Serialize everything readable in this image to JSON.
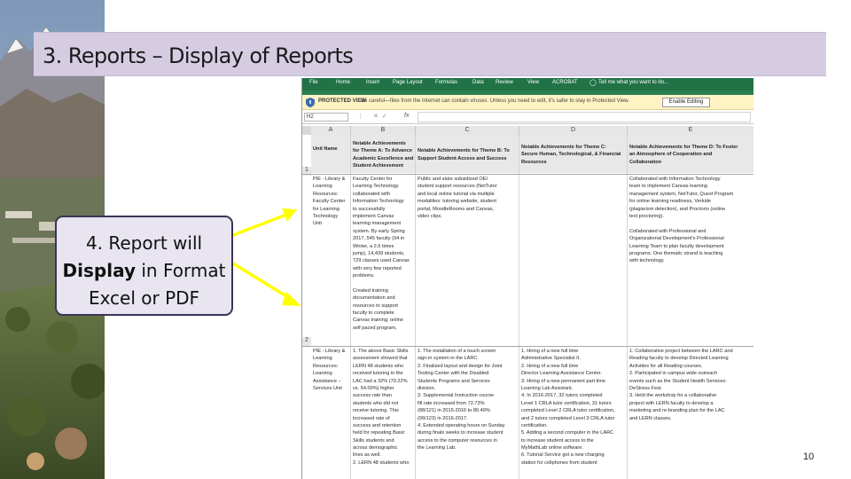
{
  "slide": {
    "title": "3. Reports – Display of Reports",
    "page_number": "10"
  },
  "callout": {
    "line1": "4. Report will",
    "line2_bold": "Display",
    "line2_rest": " in Format",
    "line3": "Excel or PDF"
  },
  "excel": {
    "ribbon_tabs": [
      "File",
      "Home",
      "Insert",
      "Page Layout",
      "Formulas",
      "Data",
      "Review",
      "View",
      "ACROBAT"
    ],
    "tell_me": "Tell me what you want to do...",
    "protected_view": {
      "label": "PROTECTED VIEW",
      "message": "Be careful—files from the Internet can contain viruses. Unless you need to edit, it's safer to stay in Protected View.",
      "button": "Enable Editing"
    },
    "name_box": "H2",
    "fx_label": "fx",
    "columns": [
      "A",
      "B",
      "C",
      "D",
      "E"
    ],
    "rows": [
      "1",
      "2"
    ],
    "header": {
      "a": [
        "",
        "Unit Name"
      ],
      "b": [
        "Notable Achievements",
        "for Theme A: To Advance",
        "Academic Excellence and",
        "Student Achievement"
      ],
      "c": [
        "",
        "Notable Achievements for Theme B: To",
        "Support Student Access and Success",
        ""
      ],
      "d": [
        "Notable Achievements for Theme C:",
        "Secure Human, Technological, & Financial",
        "Resources"
      ],
      "e": [
        "Notable Achievements for Theme D: To Foster",
        "an Atmosphere of Cooperation and",
        "Collaboration"
      ]
    },
    "row1": {
      "a": [
        "PIE - Library &",
        "Learning",
        "Resources:",
        "Faculty Center",
        "for Learning",
        "Technology",
        "Unit"
      ],
      "b": [
        "Faculty Center for",
        "Learning Technology",
        "collaborated with",
        "Information Technology",
        "to successfully",
        "implement Canvas",
        "learning management",
        "system. By early Spring",
        "2017, 545 faculty (94 in",
        "Winter, a 2.6 times",
        "jump), 14,439 students,",
        "729 classes used Canvas",
        "with very few reported",
        "problems.",
        "",
        "Created training",
        "documentation and",
        "resources to support",
        "faculty to complete",
        "Canvas training; online",
        "self paced program,"
      ],
      "c": [
        "Public and state subsidized OEI",
        "student support resources (NetTutor",
        "and local online tutorial via multiple",
        "modalities: tutoring website, student",
        "portal, MoodleRooms and Canvas,",
        "video clips."
      ],
      "d": [],
      "e": [
        "Collaborated with Information Technology",
        "team to implement Canvas learning",
        "management system, NetTutor, Quest Program",
        "for online learning readiness, Verkide",
        "(plagiarism detection), and Proctorio (online",
        "test proctoring).",
        "",
        "Collaborated with Professional and",
        "Organizational Development's Professional",
        "Learning Team to plan faculty development",
        "programs. One thematic strand is teaching",
        "with technology."
      ]
    },
    "row2": {
      "a": [
        "PIE - Library &",
        "Learning",
        "Resources:",
        "Learning",
        "Assistance –",
        "Services Unit"
      ],
      "b": [
        "1. The above Basic Skills",
        "assessment showed that",
        "LERN 48 students who",
        "received tutoring in the",
        "LAC had a 32% (70.22%",
        "vs. 54.00%) higher",
        "success rate than",
        "students who did not",
        "receive tutoring. This",
        "increased rate of",
        "success and retention",
        "held for repeating Basic",
        "Skills students and",
        "across demographic",
        "lines as well.",
        "2. LERN 48 students who"
      ],
      "c": [
        "1. The installation of a touch screen",
        "sign-in system in the LARC.",
        "2. Finalized layout and design for Joint",
        "Testing Center with the Disabled",
        "Students Programs and Services",
        "division.",
        "3. Supplemental Instruction course",
        "fill rate increased from 72.73%",
        "(88/121) in 2015-2016 to 80.49%",
        "(99/123) in 2016-2017.",
        "4. Extended operating hours on Sunday",
        "during finals weeks to increase student",
        "access to the computer resources in",
        "the Learning Lab."
      ],
      "d": [
        "1. Hiring of a new full time",
        "Administrative Specialist II.",
        "2. Hiring of a new full time",
        "Director Learning Assistance Center.",
        "3. Hiring of a new permanent part time",
        "Learning Lab Assistant.",
        "4. In 2016-2017, 32 tutors completed",
        "Level 1 CRLA tutor certification, 31 tutors",
        "completed Level 2 CRLA tutor certification,",
        "and 2 tutors completed Level 3 CRLA tutor",
        "certification.",
        "5. Adding a second computer in the LARC",
        "to increase student access to the",
        "MyMathLab online software.",
        "6. Tutorial Service got a new charging",
        "station for cellphones from student"
      ],
      "e": [
        "1. Collaborative project between the LARC and",
        "Reading faculty to develop Directed Learning",
        "Activities for all Reading courses.",
        "2. Participated in campus wide outreach",
        "events such as the Student Health Services:",
        "DeStress Fest.",
        "3. Held the workshop for a collaborative",
        "project with LERN faculty to develop a",
        "marketing and re-branding plan for the LAC",
        "and LERN classes."
      ]
    }
  }
}
